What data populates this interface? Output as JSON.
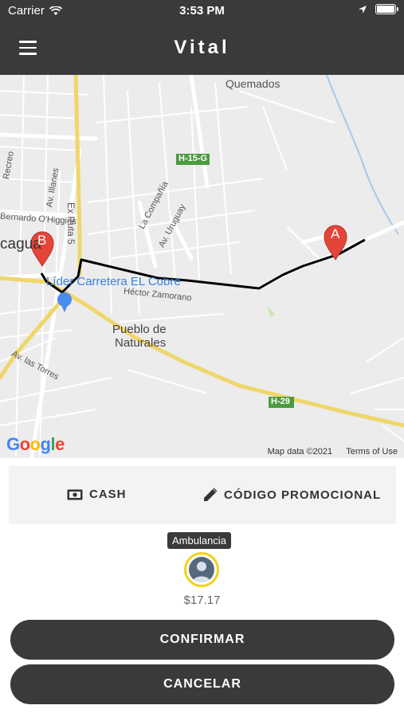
{
  "status_bar": {
    "carrier": "Carrier",
    "time": "3:53 PM"
  },
  "header": {
    "title": "Vital"
  },
  "map": {
    "labels": {
      "quemados": "Quemados",
      "h15g": "H-15-G",
      "recreo": "Recreo",
      "illanes": "Av. Illanes",
      "ohiggins": "Bernardo O'Higgins",
      "ex_ruta": "Ex Ruta 5",
      "compania": "La Compañía",
      "uruguay": "Av. Uruguay",
      "cagua": "cagua",
      "lider": "Líder Carretera EL Cobre",
      "hector": "Héctor Zamorano",
      "pueblo1": "Pueblo de",
      "pueblo2": "Naturales",
      "torres": "Av. las Torres",
      "h29": "H-29"
    },
    "marker_a": "A",
    "marker_b": "B",
    "attribution_data": "Map data ©2021",
    "attribution_terms": "Terms of Use",
    "logo": "Google"
  },
  "options": {
    "payment": "CASH",
    "promo": "CÓDIGO PROMOCIONAL"
  },
  "vehicle": {
    "name": "Ambulancia",
    "price": "$17.17"
  },
  "buttons": {
    "confirm": "CONFIRMAR",
    "cancel": "CANCELAR"
  },
  "colors": {
    "header": "#3a3a3a",
    "accent": "#f2d21a",
    "marker": "#e4443a"
  }
}
